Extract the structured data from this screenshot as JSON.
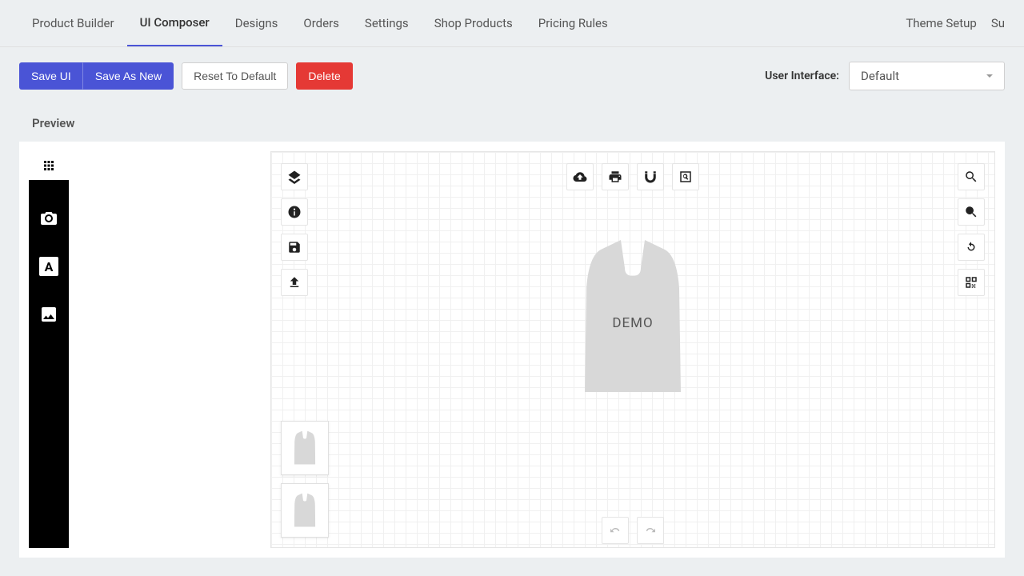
{
  "nav": {
    "left": [
      "Product Builder",
      "UI Composer",
      "Designs",
      "Orders",
      "Settings",
      "Shop Products",
      "Pricing Rules"
    ],
    "active_index": 1,
    "right": [
      "Theme Setup",
      "Su"
    ]
  },
  "toolbar": {
    "save_ui": "Save UI",
    "save_as_new": "Save As New",
    "reset": "Reset To Default",
    "delete": "Delete",
    "ui_label": "User Interface:",
    "ui_value": "Default"
  },
  "preview": {
    "title": "Preview",
    "demo_label": "DEMO",
    "rail_icons": [
      "grid",
      "camera",
      "text",
      "image"
    ],
    "left_tools": [
      "layers",
      "info",
      "save",
      "upload"
    ],
    "top_tools": [
      "cloud-download",
      "print",
      "magnet",
      "search-box"
    ],
    "right_tools": [
      "search",
      "zoom-in",
      "refresh",
      "qr"
    ],
    "bottom_tools": [
      "undo",
      "redo"
    ]
  }
}
